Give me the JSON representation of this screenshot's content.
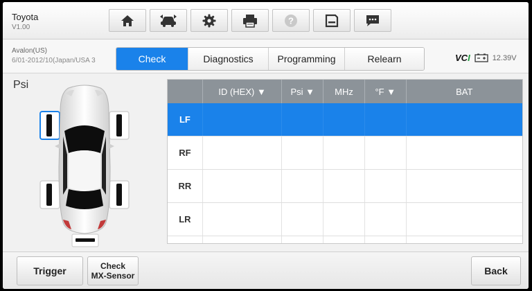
{
  "header": {
    "vehicle": "Toyota",
    "version": "V1.00",
    "toolbar": [
      {
        "name": "home-icon"
      },
      {
        "name": "vehicle-swap-icon"
      },
      {
        "name": "settings-gear-icon"
      },
      {
        "name": "print-icon"
      },
      {
        "name": "help-icon"
      },
      {
        "name": "save-icon"
      },
      {
        "name": "message-icon"
      }
    ]
  },
  "subheader": {
    "model": "Avalon(US)",
    "years": "6/01-2012/10(Japan/USA 3",
    "tabs": [
      "Check",
      "Diagnostics",
      "Programming",
      "Relearn"
    ],
    "active_tab": "Check",
    "vci_label": "VCI",
    "voltage": "12.39V"
  },
  "main": {
    "unit": "Psi",
    "selected_wheel": "LF",
    "table": {
      "columns": [
        "",
        "ID (HEX) ▼",
        "Psi ▼",
        "MHz",
        "°F ▼",
        "BAT"
      ],
      "rows": [
        {
          "label": "LF",
          "values": [
            "",
            "",
            "",
            "",
            ""
          ]
        },
        {
          "label": "RF",
          "values": [
            "",
            "",
            "",
            "",
            ""
          ]
        },
        {
          "label": "RR",
          "values": [
            "",
            "",
            "",
            "",
            ""
          ]
        },
        {
          "label": "LR",
          "values": [
            "",
            "",
            "",
            "",
            ""
          ]
        }
      ]
    }
  },
  "footer": {
    "trigger": "Trigger",
    "check_line1": "Check",
    "check_line2": "MX-Sensor",
    "back": "Back"
  },
  "colors": {
    "accent": "#1a82ea",
    "header_bg": "#8c9399",
    "vci_green": "#1d9a3c"
  }
}
